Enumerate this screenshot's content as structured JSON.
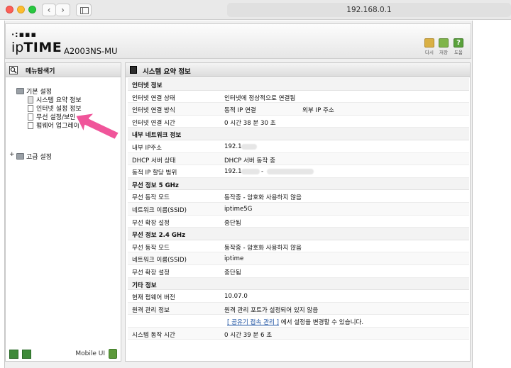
{
  "browser": {
    "url": "192.168.0.1"
  },
  "header": {
    "logo_dots": "·:▪▪▪",
    "logo_ip": "ip",
    "logo_time": "TIME",
    "model": "A2003NS-MU",
    "buttons": [
      {
        "label": "다시"
      },
      {
        "label": "저장"
      },
      {
        "label": "도움"
      }
    ]
  },
  "sidebar": {
    "title": "메뉴탐색기",
    "basic_group": "기본 설정",
    "items": [
      {
        "label": "시스템 요약 정보"
      },
      {
        "label": "인터넷 설정 정보"
      },
      {
        "label": "무선 설정/보안"
      },
      {
        "label": "펌웨어 업그레이"
      }
    ],
    "advanced_group": "고급 설정",
    "mobile_ui": "Mobile UI"
  },
  "main": {
    "title": "시스템 요약 정보",
    "internet_section": "인터넷 정보",
    "internet_rows": [
      {
        "label": "인터넷 연결 상태",
        "value": "인터넷에 정상적으로 연결됨"
      },
      {
        "label": "인터넷 연결 방식",
        "value": "동적 IP 연결",
        "extra_label": "외부 IP 주소"
      },
      {
        "label": "인터넷 연결 시간",
        "value": "0 시간 38 분 30 초"
      }
    ],
    "lan_section": "내부 네트워크 정보",
    "lan_rows": [
      {
        "label": "내부 IP주소",
        "value": "192.1"
      },
      {
        "label": "DHCP 서버 상태",
        "value": "DHCP 서버 동작 중"
      },
      {
        "label": "동적 IP 할당 범위",
        "value": "192.1",
        "value_suffix": "-"
      }
    ],
    "wifi5_section": "무선 정보 5 GHz",
    "wifi5_rows": [
      {
        "label": "무선 동작 모드",
        "value": "동작중 - 암호화 사용하지 않음"
      },
      {
        "label": "네트워크 이름(SSID)",
        "value": "iptime5G"
      },
      {
        "label": "무선 확장 설정",
        "value": "중단됨"
      }
    ],
    "wifi24_section": "무선 정보 2.4 GHz",
    "wifi24_rows": [
      {
        "label": "무선 동작 모드",
        "value": "동작중 - 암호화 사용하지 않음"
      },
      {
        "label": "네트워크 이름(SSID)",
        "value": "iptime"
      },
      {
        "label": "무선 확장 설정",
        "value": "중단됨"
      }
    ],
    "etc_section": "기타 정보",
    "etc_rows": [
      {
        "label": "현재 펌웨어 버전",
        "value": "10.07.0"
      },
      {
        "label": "원격 관리 정보",
        "value": "원격 관리 포트가 설정되어 있지 않음"
      },
      {
        "label": "",
        "link": "[ 공유기 접속 관리 ]",
        "value": "에서 설정을 변경할 수 있습니다."
      },
      {
        "label": "시스템 동작 시간",
        "value": "0 시간 39 분 6 초"
      }
    ]
  }
}
